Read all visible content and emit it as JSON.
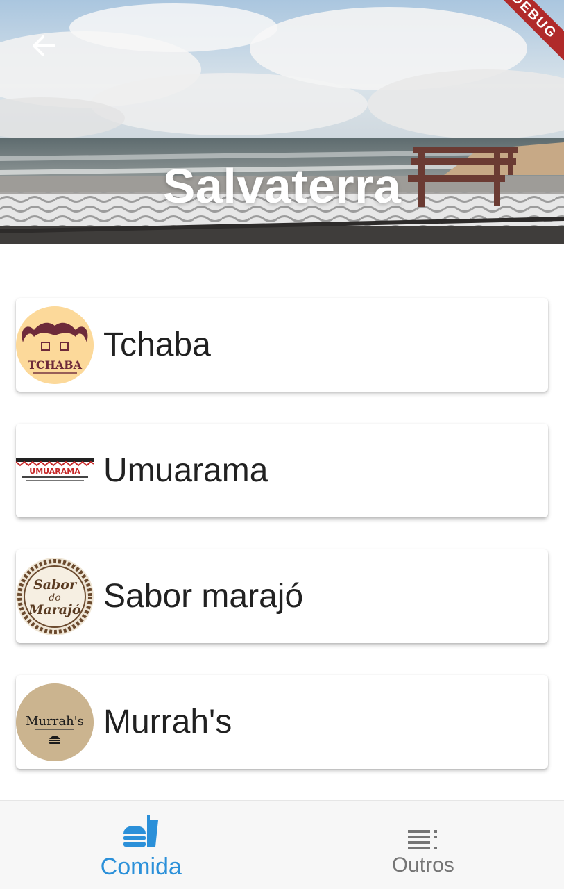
{
  "header": {
    "title": "Salvaterra",
    "debug_banner": "DEBUG"
  },
  "restaurants": [
    {
      "name": "Tchaba",
      "logo_text": "TCHABA",
      "logo_bg": "#fcd99a"
    },
    {
      "name": "Umuarama",
      "logo_text": "UMUARAMA",
      "logo_bg": "#ffffff"
    },
    {
      "name": "Sabor marajó",
      "logo_text_1": "Sabor",
      "logo_text_2": "do",
      "logo_text_3": "Marajó",
      "logo_bg": "#efe6d6"
    },
    {
      "name": "Murrah's",
      "logo_text": "Murrah's",
      "logo_bg": "#c9b08a"
    }
  ],
  "bottom_nav": {
    "items": [
      {
        "label": "Comida",
        "icon": "fastfood-icon",
        "active": true
      },
      {
        "label": "Outros",
        "icon": "list-icon",
        "active": false
      }
    ]
  },
  "colors": {
    "accent": "#2b90d9",
    "inactive": "#757575",
    "text": "#212121"
  }
}
